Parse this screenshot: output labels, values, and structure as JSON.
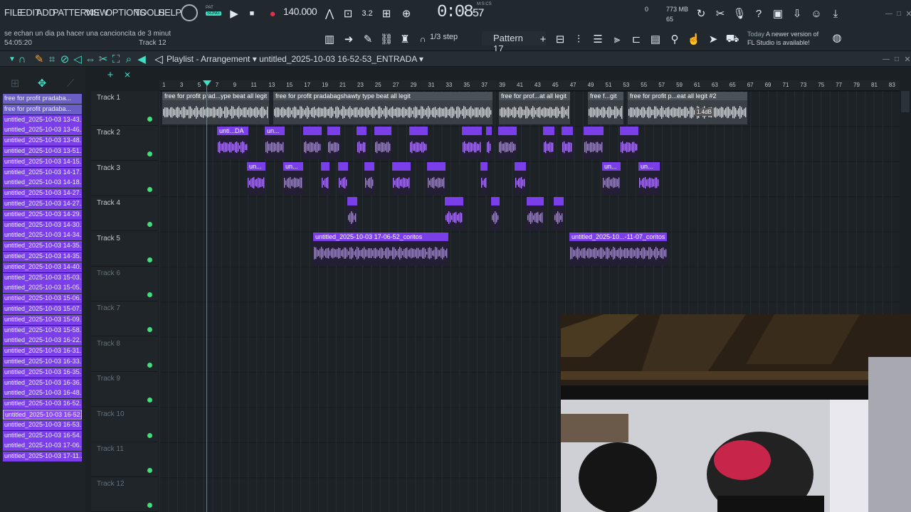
{
  "menu": [
    "FILE",
    "EDIT",
    "ADD",
    "PATTERNS",
    "VIEW",
    "OPTIONS",
    "TOOLS",
    "HELP"
  ],
  "transport": {
    "pat_label": "PAT",
    "song_label": "SONG",
    "tempo": "140.000",
    "time_main": "0:08",
    "time_sub": "57",
    "time_format": "M:S:CS"
  },
  "hint": {
    "text": "se echan un dia pa hacer una cancioncita de 3 minut",
    "position": "54:05:20",
    "track": "Track 12"
  },
  "memory": {
    "cpu_label": "0",
    "ram": "773 MB",
    "poly": "65"
  },
  "snap": "1/3 step",
  "pattern": "Pattern 17",
  "news": {
    "when": "Today",
    "line1": "A newer version of",
    "line2": "FL Studio is available!"
  },
  "playlist": {
    "title": "Playlist - Arrangement",
    "file": "untitled_2025-10-03 16-52-53_ENTRADA"
  },
  "browser_items": [
    {
      "label": "free for profit pradaba...",
      "style": "first"
    },
    {
      "label": "free for profit pradaba...",
      "style": "first"
    },
    {
      "label": "untitled_2025-10-03 13-43...",
      "style": "audio"
    },
    {
      "label": "untitled_2025-10-03 13-46...",
      "style": "audio"
    },
    {
      "label": "untitled_2025-10-03 13-48...",
      "style": "audio"
    },
    {
      "label": "untitled_2025-10-03 13-51...",
      "style": "audio"
    },
    {
      "label": "untitled_2025-10-03 14-15...",
      "style": "audio"
    },
    {
      "label": "untitled_2025-10-03 14-17...",
      "style": "audio"
    },
    {
      "label": "untitled_2025-10-03 14-18...",
      "style": "audio"
    },
    {
      "label": "untitled_2025-10-03 14-27...",
      "style": "audio"
    },
    {
      "label": "untitled_2025-10-03 14-27...",
      "style": "audio"
    },
    {
      "label": "untitled_2025-10-03 14-29...",
      "style": "audio"
    },
    {
      "label": "untitled_2025-10-03 14-30...",
      "style": "audio"
    },
    {
      "label": "untitled_2025-10-03 14-34...",
      "style": "audio"
    },
    {
      "label": "untitled_2025-10-03 14-35...",
      "style": "audio"
    },
    {
      "label": "untitled_2025-10-03 14-35...",
      "style": "audio"
    },
    {
      "label": "untitled_2025-10-03 14-40...",
      "style": "audio"
    },
    {
      "label": "untitled_2025-10-03 15-03...",
      "style": "audio"
    },
    {
      "label": "untitled_2025-10-03 15-05...",
      "style": "audio"
    },
    {
      "label": "untitled_2025-10-03 15-06...",
      "style": "audio"
    },
    {
      "label": "untitled_2025-10-03 15-07...",
      "style": "audio"
    },
    {
      "label": "untitled_2025-10-03 15-09...",
      "style": "audio"
    },
    {
      "label": "untitled_2025-10-03 15-58...",
      "style": "audio"
    },
    {
      "label": "untitled_2025-10-03 16-22...",
      "style": "audio"
    },
    {
      "label": "untitled_2025-10-03 16-31...",
      "style": "audio"
    },
    {
      "label": "untitled_2025-10-03 16-33...",
      "style": "audio"
    },
    {
      "label": "untitled_2025-10-03 16-35...",
      "style": "audio"
    },
    {
      "label": "untitled_2025-10-03 16-36...",
      "style": "audio"
    },
    {
      "label": "untitled_2025-10-03 16-48...",
      "style": "audio"
    },
    {
      "label": "untitled_2025-10-03 16-52...",
      "style": "audio"
    },
    {
      "label": "untitled_2025-10-03 16-52...",
      "style": "white"
    },
    {
      "label": "untitled_2025-10-03 16-53...",
      "style": "audio"
    },
    {
      "label": "untitled_2025-10-03 16-54...",
      "style": "audio"
    },
    {
      "label": "untitled_2025-10-03 17-06...",
      "style": "audio"
    },
    {
      "label": "untitled_2025-10-03 17-11...",
      "style": "audio"
    }
  ],
  "tracks": [
    "Track 1",
    "Track 2",
    "Track 3",
    "Track 4",
    "Track 5",
    "Track 6",
    "Track 7",
    "Track 8",
    "Track 9",
    "Track 10",
    "Track 11",
    "Track 12"
  ],
  "ruler": [
    "1",
    "3",
    "5",
    "7",
    "9",
    "11",
    "13",
    "15",
    "17",
    "19",
    "21",
    "23",
    "25",
    "27",
    "29",
    "31",
    "33",
    "35",
    "37",
    "39",
    "41",
    "43",
    "45",
    "47",
    "49",
    "51",
    "53",
    "55",
    "57",
    "59",
    "61",
    "63",
    "65",
    "67",
    "69",
    "71",
    "73",
    "75",
    "77",
    "79",
    "81",
    "83"
  ],
  "clips_track1": [
    "free for profit prad...ype beat all legit",
    "free for profit pradabagshawty type beat all legit",
    "free for prof...at all legit",
    "free f...git",
    "free f...gi",
    "free for profit p...eat all legit #2"
  ],
  "clips_track2": [
    "unti...DA",
    "un...",
    "",
    "",
    "",
    "",
    "",
    "",
    "",
    "",
    "",
    "un...",
    ""
  ],
  "clips_track3": [
    "un...",
    "un...",
    "",
    "",
    "",
    "",
    "",
    "",
    "",
    "un...",
    "un..."
  ],
  "clip_track5": [
    "untitled_2025-10-03 17-06-52_coritos",
    "untitled_2025-10...-11-07_coritos"
  ],
  "gain_label": "1.4dB",
  "colors": {
    "accent": "#3fe0c5",
    "clip_purple": "#7a3fe8",
    "clip_gray": "#4b5257"
  }
}
